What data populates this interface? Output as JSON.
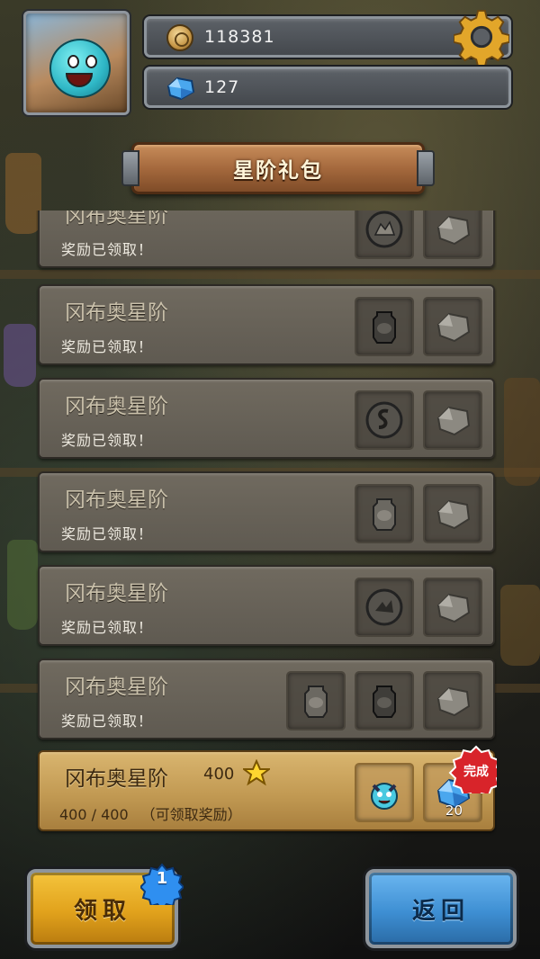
{
  "resources": {
    "coins": "118381",
    "gems": "127"
  },
  "header": {
    "title": "星阶礼包"
  },
  "rows": [
    {
      "title": "冈布奥星阶",
      "status": "奖励已领取！",
      "rewards": [
        "beast-token-icon",
        "gem-icon"
      ]
    },
    {
      "title": "冈布奥星阶",
      "status": "奖励已领取！",
      "rewards": [
        "jar-icon",
        "gem-icon"
      ]
    },
    {
      "title": "冈布奥星阶",
      "status": "奖励已领取！",
      "rewards": [
        "snake-token-icon",
        "gem-icon"
      ]
    },
    {
      "title": "冈布奥星阶",
      "status": "奖励已领取！",
      "rewards": [
        "jar-icon",
        "gem-icon"
      ]
    },
    {
      "title": "冈布奥星阶",
      "status": "奖励已领取！",
      "rewards": [
        "dragon-token-icon",
        "gem-icon"
      ]
    },
    {
      "title": "冈布奥星阶",
      "status": "奖励已领取！",
      "rewards": [
        "jar-icon",
        "jar-icon",
        "gem-icon"
      ]
    }
  ],
  "active_row": {
    "title": "冈布奥星阶",
    "star_requirement": "400",
    "progress": "400 / 400",
    "progress_note": "（可领取奖励）",
    "gem_reward_qty": "20",
    "done_label": "完成",
    "rewards": [
      "gumball-character-icon",
      "gem-icon"
    ]
  },
  "buttons": {
    "claim_label": "领取",
    "claim_badge": "1",
    "back_label": "返回"
  },
  "colors": {
    "claim_button": "#e1a21c",
    "back_button": "#3e8fd3",
    "active_row": "#c29a53",
    "collected_row": "#66615a",
    "done_badge": "#d8242a"
  }
}
